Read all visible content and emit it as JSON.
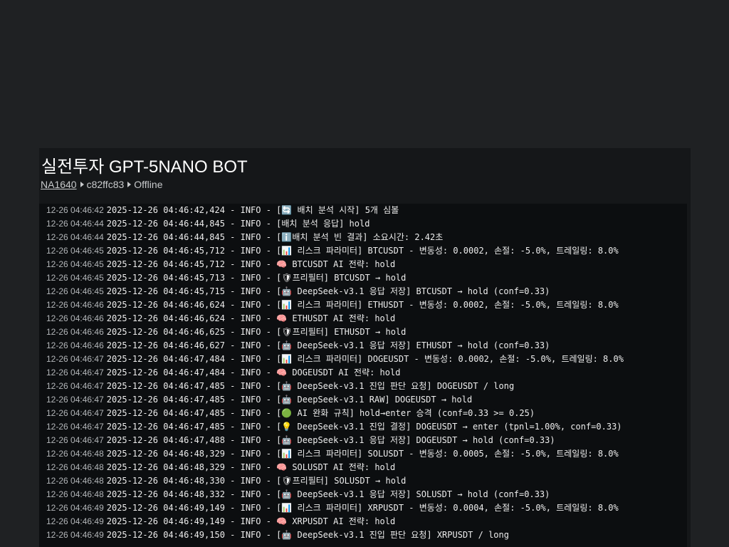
{
  "page": {
    "title": "실전투자 GPT-5NANO BOT",
    "breadcrumb": {
      "user": "NA1640",
      "id": "c82ffc83",
      "status": "Offline"
    }
  },
  "log": [
    {
      "ts": "12-26 04:46:42",
      "msg": "2025-12-26 04:46:42,424 - INFO - [🔄 배치 분석 시작] 5개 심볼"
    },
    {
      "ts": "12-26 04:46:44",
      "msg": "2025-12-26 04:46:44,845 - INFO - [배치 분석 응답] hold"
    },
    {
      "ts": "12-26 04:46:44",
      "msg": "2025-12-26 04:46:44,845 - INFO - [ℹ️배치 분석 빈 결과] 소요시간: 2.42초"
    },
    {
      "ts": "12-26 04:46:45",
      "msg": "2025-12-26 04:46:45,712 - INFO - [📊 리스크 파라미터] BTCUSDT - 변동성: 0.0002, 손절: -5.0%, 트레일링: 8.0%"
    },
    {
      "ts": "12-26 04:46:45",
      "msg": "2025-12-26 04:46:45,712 - INFO - 🧠 BTCUSDT AI 전략: hold"
    },
    {
      "ts": "12-26 04:46:45",
      "msg": "2025-12-26 04:46:45,713 - INFO - [🛡프리필터] BTCUSDT → hold"
    },
    {
      "ts": "12-26 04:46:45",
      "msg": "2025-12-26 04:46:45,715 - INFO - [🤖 DeepSeek-v3.1 응답 저장] BTCUSDT → hold (conf=0.33)"
    },
    {
      "ts": "12-26 04:46:46",
      "msg": "2025-12-26 04:46:46,624 - INFO - [📊 리스크 파라미터] ETHUSDT - 변동성: 0.0002, 손절: -5.0%, 트레일링: 8.0%"
    },
    {
      "ts": "12-26 04:46:46",
      "msg": "2025-12-26 04:46:46,624 - INFO - 🧠 ETHUSDT AI 전략: hold"
    },
    {
      "ts": "12-26 04:46:46",
      "msg": "2025-12-26 04:46:46,625 - INFO - [🛡프리필터] ETHUSDT → hold"
    },
    {
      "ts": "12-26 04:46:46",
      "msg": "2025-12-26 04:46:46,627 - INFO - [🤖 DeepSeek-v3.1 응답 저장] ETHUSDT → hold (conf=0.33)"
    },
    {
      "ts": "12-26 04:46:47",
      "msg": "2025-12-26 04:46:47,484 - INFO - [📊 리스크 파라미터] DOGEUSDT - 변동성: 0.0002, 손절: -5.0%, 트레일링: 8.0%"
    },
    {
      "ts": "12-26 04:46:47",
      "msg": "2025-12-26 04:46:47,484 - INFO - 🧠 DOGEUSDT AI 전략: hold"
    },
    {
      "ts": "12-26 04:46:47",
      "msg": "2025-12-26 04:46:47,485 - INFO - [🤖 DeepSeek-v3.1 진입 판단 요청] DOGEUSDT / long"
    },
    {
      "ts": "12-26 04:46:47",
      "msg": "2025-12-26 04:46:47,485 - INFO - [🤖 DeepSeek-v3.1 RAW] DOGEUSDT → hold"
    },
    {
      "ts": "12-26 04:46:47",
      "msg": "2025-12-26 04:46:47,485 - INFO - [🟢 AI 완화 규칙] hold→enter 승격 (conf=0.33 >= 0.25)"
    },
    {
      "ts": "12-26 04:46:47",
      "msg": "2025-12-26 04:46:47,485 - INFO - [💡 DeepSeek-v3.1 진입 결정] DOGEUSDT → enter (tpnl=1.00%, conf=0.33)"
    },
    {
      "ts": "12-26 04:46:47",
      "msg": "2025-12-26 04:46:47,488 - INFO - [🤖 DeepSeek-v3.1 응답 저장] DOGEUSDT → hold (conf=0.33)"
    },
    {
      "ts": "12-26 04:46:48",
      "msg": "2025-12-26 04:46:48,329 - INFO - [📊 리스크 파라미터] SOLUSDT - 변동성: 0.0005, 손절: -5.0%, 트레일링: 8.0%"
    },
    {
      "ts": "12-26 04:46:48",
      "msg": "2025-12-26 04:46:48,329 - INFO - 🧠 SOLUSDT AI 전략: hold"
    },
    {
      "ts": "12-26 04:46:48",
      "msg": "2025-12-26 04:46:48,330 - INFO - [🛡프리필터] SOLUSDT → hold"
    },
    {
      "ts": "12-26 04:46:48",
      "msg": "2025-12-26 04:46:48,332 - INFO - [🤖 DeepSeek-v3.1 응답 저장] SOLUSDT → hold (conf=0.33)"
    },
    {
      "ts": "12-26 04:46:49",
      "msg": "2025-12-26 04:46:49,149 - INFO - [📊 리스크 파라미터] XRPUSDT - 변동성: 0.0004, 손절: -5.0%, 트레일링: 8.0%"
    },
    {
      "ts": "12-26 04:46:49",
      "msg": "2025-12-26 04:46:49,149 - INFO - 🧠 XRPUSDT AI 전략: hold"
    },
    {
      "ts": "12-26 04:46:49",
      "msg": "2025-12-26 04:46:49,150 - INFO - [🤖 DeepSeek-v3.1 진입 판단 요청] XRPUSDT / long"
    }
  ]
}
